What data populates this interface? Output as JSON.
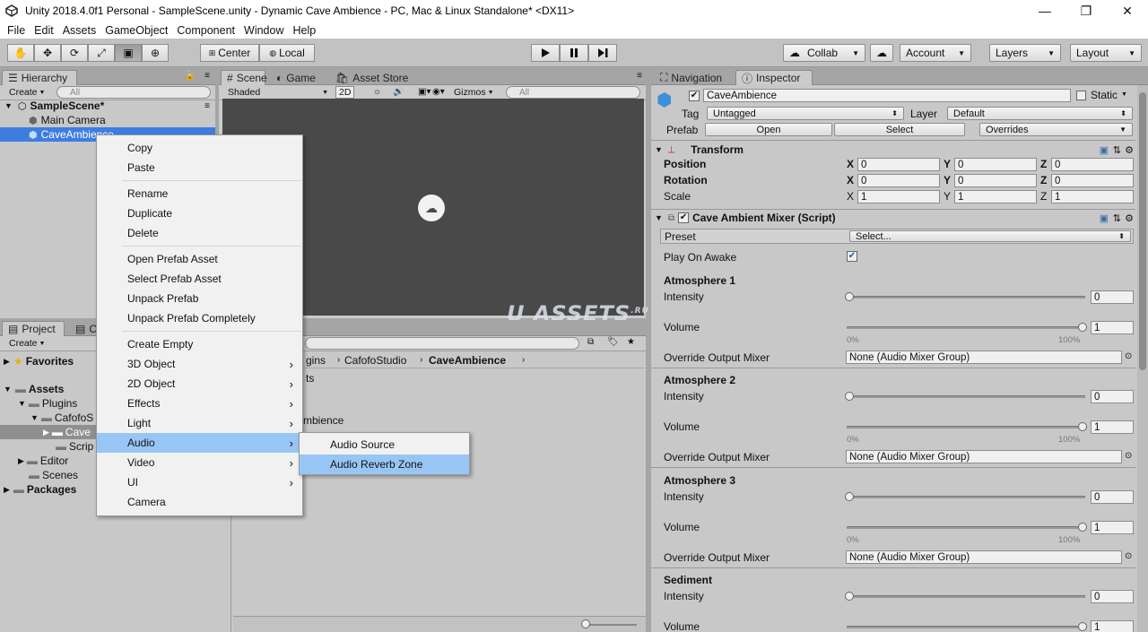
{
  "window": {
    "title": "Unity 2018.4.0f1 Personal - SampleScene.unity - Dynamic Cave Ambience - PC, Mac & Linux Standalone* <DX11>",
    "controls": [
      "—",
      "❐",
      "✕"
    ]
  },
  "menubar": [
    "File",
    "Edit",
    "Assets",
    "GameObject",
    "Component",
    "Window",
    "Help"
  ],
  "toolbar": {
    "tools": [
      "hand-tool",
      "move-tool",
      "rotate-tool",
      "scale-tool",
      "rect-tool",
      "transform-tool"
    ],
    "pivot": "Center",
    "space": "Local",
    "collab": "Collab",
    "account": "Account",
    "layers": "Layers",
    "layout": "Layout"
  },
  "hierarchy": {
    "tab": "Hierarchy",
    "create": "Create",
    "search_placeholder": "All",
    "scene": "SampleScene*",
    "items": [
      "Main Camera",
      "CaveAmbience"
    ]
  },
  "scene": {
    "tabs": [
      "Scene",
      "Game",
      "Asset Store"
    ],
    "shading": "Shaded",
    "mode2d": "2D",
    "gizmos": "Gizmos",
    "search_placeholder": "All"
  },
  "project": {
    "tabs": [
      "Project",
      "C"
    ],
    "create": "Create",
    "favorites": "Favorites",
    "assets": "Assets",
    "tree": [
      "Plugins",
      "CafofoS",
      "Cave",
      "Scrip",
      "Editor",
      "Scenes"
    ],
    "packages": "Packages",
    "breadcrumb": [
      "gins",
      "CafofoStudio",
      "CaveAmbience"
    ],
    "content": [
      "ts",
      "mbience"
    ]
  },
  "context_menu": {
    "items": [
      {
        "label": "Copy"
      },
      {
        "label": "Paste"
      },
      {
        "sep": true
      },
      {
        "label": "Rename"
      },
      {
        "label": "Duplicate"
      },
      {
        "label": "Delete"
      },
      {
        "sep": true
      },
      {
        "label": "Open Prefab Asset"
      },
      {
        "label": "Select Prefab Asset"
      },
      {
        "label": "Unpack Prefab"
      },
      {
        "label": "Unpack Prefab Completely"
      },
      {
        "sep": true
      },
      {
        "label": "Create Empty"
      },
      {
        "label": "3D Object",
        "sub": true
      },
      {
        "label": "2D Object",
        "sub": true
      },
      {
        "label": "Effects",
        "sub": true
      },
      {
        "label": "Light",
        "sub": true
      },
      {
        "label": "Audio",
        "sub": true
      },
      {
        "label": "Video",
        "sub": true
      },
      {
        "label": "UI",
        "sub": true
      },
      {
        "label": "Camera"
      }
    ],
    "submenu": [
      "Audio Source",
      "Audio Reverb Zone"
    ]
  },
  "inspector": {
    "tabs": [
      "Navigation",
      "Inspector"
    ],
    "object_name": "CaveAmbience",
    "static_label": "Static",
    "tag_label": "Tag",
    "tag_value": "Untagged",
    "layer_label": "Layer",
    "layer_value": "Default",
    "prefab_label": "Prefab",
    "prefab_open": "Open",
    "prefab_select": "Select",
    "prefab_overrides": "Overrides",
    "transform": {
      "title": "Transform",
      "rows": [
        {
          "label": "Position",
          "x": "0",
          "y": "0",
          "z": "0"
        },
        {
          "label": "Rotation",
          "x": "0",
          "y": "0",
          "z": "0"
        },
        {
          "label": "Scale",
          "x": "1",
          "y": "1",
          "z": "1"
        }
      ]
    },
    "script": {
      "title": "Cave Ambient Mixer (Script)",
      "preset_label": "Preset",
      "preset_value": "Select...",
      "play_on_awake": "Play On Awake",
      "sections": [
        {
          "title": "Atmosphere 1",
          "intensity": "0",
          "volume": "1",
          "mixer": "None (Audio Mixer Group)"
        },
        {
          "title": "Atmosphere 2",
          "intensity": "0",
          "volume": "1",
          "mixer": "None (Audio Mixer Group)"
        },
        {
          "title": "Atmosphere 3",
          "intensity": "0",
          "volume": "1",
          "mixer": "None (Audio Mixer Group)"
        },
        {
          "title": "Sediment",
          "intensity": "0",
          "volume": "1"
        }
      ],
      "intensity_label": "Intensity",
      "volume_label": "Volume",
      "override_label": "Override Output Mixer",
      "pct_min": "0%",
      "pct_max": "100%"
    }
  },
  "watermark": "U ASSETS",
  "watermark_sup": ".RU"
}
